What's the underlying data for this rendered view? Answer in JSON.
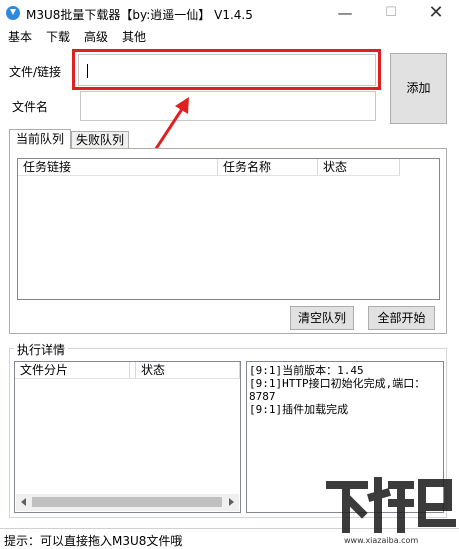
{
  "window": {
    "title": "M3U8批量下载器【by:逍遥一仙】  V1.4.5",
    "min_symbol": "—",
    "max_symbol": "☐",
    "close_symbol": "✕"
  },
  "menu": [
    "基本",
    "下载",
    "高级",
    "其他"
  ],
  "form": {
    "file_label": "文件/链接",
    "file_value": "",
    "name_label": "文件名",
    "name_value": "",
    "add_button": "添加"
  },
  "tabs": [
    {
      "label": "当前队列",
      "active": true
    },
    {
      "label": "失败队列",
      "active": false
    }
  ],
  "queue": {
    "columns": [
      "任务链接",
      "任务名称",
      "状态"
    ],
    "rows": [],
    "clear_button": "清空队列",
    "start_button": "全部开始"
  },
  "details": {
    "title": "执行详情",
    "columns": [
      "文件分片",
      "状态"
    ],
    "rows": [],
    "log": [
      "[9:1]当前版本：1.45",
      "[9:1]HTTP接口初始化完成,端口：8787",
      "[9:1]插件加载完成"
    ]
  },
  "status": {
    "text": "提示：可以直接拖入M3U8文件哦"
  },
  "watermark": {
    "text": "下载吧",
    "url": "www.xiazaiba.com"
  },
  "colors": {
    "highlight_box": "#e02020",
    "arrow": "#e02020",
    "app_icon": "#2d8ae0"
  },
  "icons": {
    "app": "download-icon",
    "annotation": "red-arrow-icon"
  }
}
